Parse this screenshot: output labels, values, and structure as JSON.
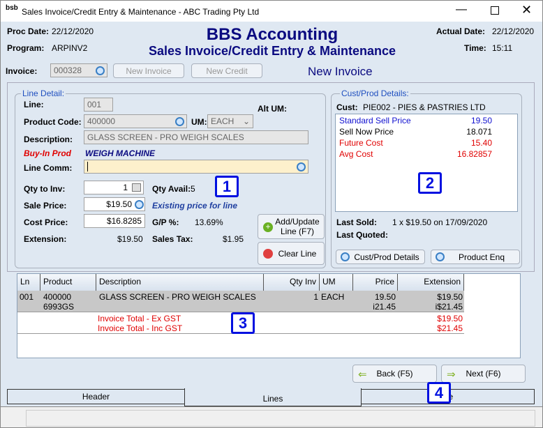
{
  "window": {
    "title": "Sales Invoice/Credit Entry & Maintenance - ABC Trading Pty Ltd",
    "logo": "bsb"
  },
  "header": {
    "proc_date_label": "Proc Date:",
    "proc_date": "22/12/2020",
    "program_label": "Program:",
    "program": "ARPINV2",
    "app_title": "BBS Accounting",
    "subtitle": "Sales Invoice/Credit Entry & Maintenance",
    "actual_date_label": "Actual Date:",
    "actual_date": "22/12/2020",
    "time_label": "Time:",
    "time": "15:11"
  },
  "invoice": {
    "label": "Invoice:",
    "value": "000328",
    "new_invoice": "New Invoice",
    "new_credit": "New Credit",
    "mode": "New Invoice"
  },
  "line_detail": {
    "title": "Line Detail:",
    "line_label": "Line:",
    "line": "001",
    "product_code_label": "Product Code:",
    "product_code": "400000",
    "um_label": "UM:",
    "um": "EACH",
    "alt_um_label": "Alt UM:",
    "description_label": "Description:",
    "description": "GLASS SCREEN - PRO WEIGH SCALES",
    "buyin_label": "Buy-In Prod",
    "buyin_value": "WEIGH MACHINE",
    "line_comm_label": "Line Comm:",
    "line_comm": "",
    "qty_label": "Qty to Inv:",
    "qty": "1",
    "qty_avail_label": "Qty Avail:",
    "qty_avail": "5",
    "sale_price_label": "Sale Price:",
    "sale_price": "$19.50",
    "price_note": "Existing price for line",
    "cost_price_label": "Cost Price:",
    "cost_price": "$16.8285",
    "gp_label": "G/P %:",
    "gp": "13.69%",
    "extension_label": "Extension:",
    "extension": "$19.50",
    "sales_tax_label": "Sales Tax:",
    "sales_tax": "$1.95",
    "add_update": "Add/Update Line (F7)",
    "clear_line": "Clear Line"
  },
  "cust_prod": {
    "title": "Cust/Prod Details:",
    "cust_label": "Cust:",
    "cust": "PIE002 - PIES & PASTRIES LTD",
    "prices": [
      {
        "label": "Standard Sell Price",
        "value": "19.50",
        "color": "#1010d0"
      },
      {
        "label": "Sell Now Price",
        "value": "18.071",
        "color": "#000000"
      },
      {
        "label": "Future Cost",
        "value": "15.40",
        "color": "#e00000"
      },
      {
        "label": "Avg Cost",
        "value": "16.82857",
        "color": "#e00000"
      }
    ],
    "last_sold_label": "Last Sold:",
    "last_sold": "1 x $19.50 on 17/09/2020",
    "last_quoted_label": "Last Quoted:",
    "details_btn": "Cust/Prod Details",
    "enq_btn": "Product Enq"
  },
  "grid": {
    "columns": [
      "Ln",
      "Product",
      "Description",
      "Qty Inv",
      "UM",
      "Price",
      "Extension"
    ],
    "rows": [
      {
        "ln": "001",
        "product": "400000",
        "product2": "6993GS",
        "description": "GLASS SCREEN - PRO WEIGH SCALES",
        "qty": "1",
        "um": "EACH",
        "price": "19.50",
        "price2": "i21.45",
        "ext": "$19.50",
        "ext2": "i$21.45"
      }
    ],
    "total_ex_label": "Invoice Total - Ex GST",
    "total_ex": "$19.50",
    "total_inc_label": "Invoice Total - Inc GST",
    "total_inc": "$21.45"
  },
  "nav": {
    "back": "Back (F5)",
    "next": "Next (F6)"
  },
  "tabs": [
    "Header",
    "Lines",
    "ise"
  ],
  "callouts": [
    "1",
    "2",
    "3",
    "4"
  ]
}
